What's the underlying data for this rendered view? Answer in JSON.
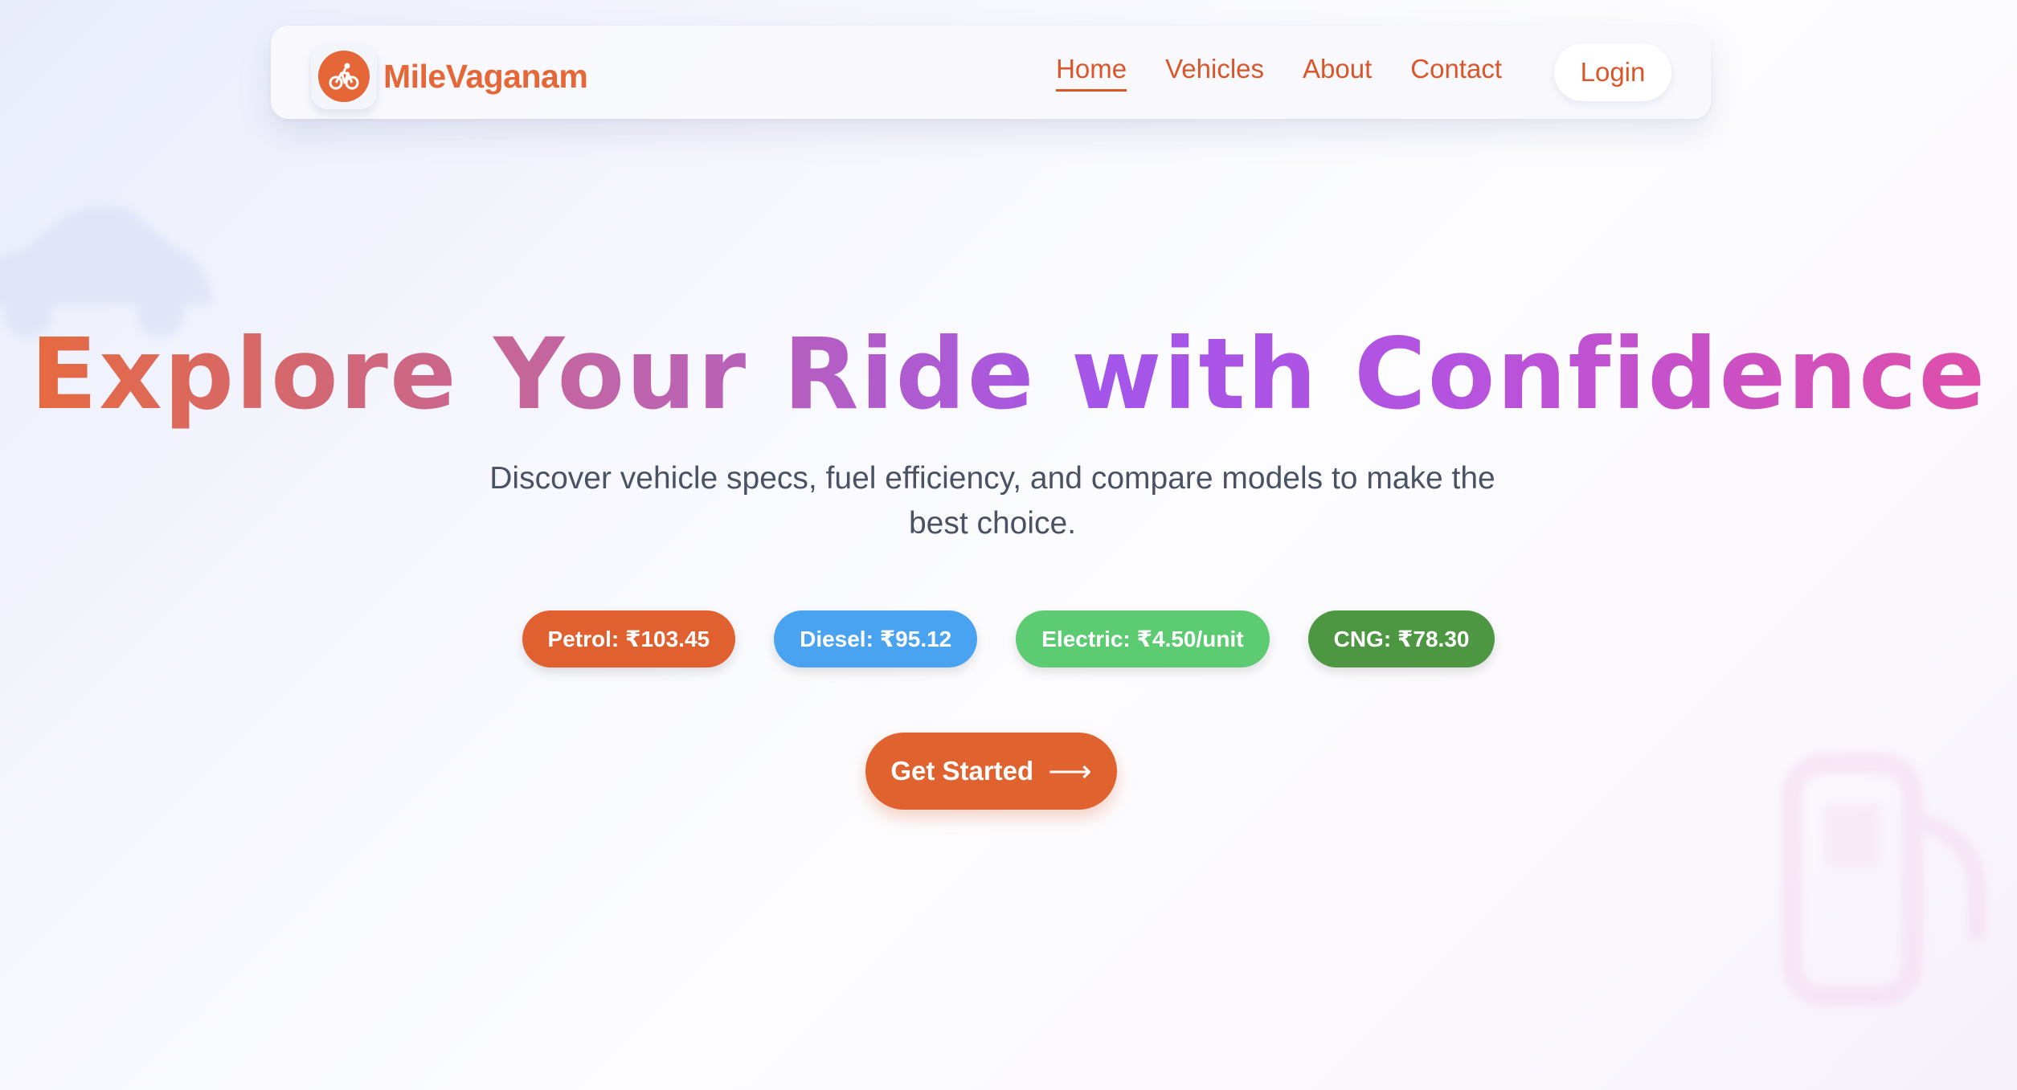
{
  "brand": {
    "name": "MileVaganam",
    "logo_icon": "motorcycle-rider-icon"
  },
  "nav": {
    "links": [
      {
        "label": "Home",
        "active": true
      },
      {
        "label": "Vehicles",
        "active": false
      },
      {
        "label": "About",
        "active": false
      },
      {
        "label": "Contact",
        "active": false
      }
    ],
    "login_label": "Login"
  },
  "hero": {
    "title": "Explore Your Ride with Confidence",
    "subtitle": "Discover vehicle specs, fuel efficiency, and compare models to make the best choice."
  },
  "fuel_prices": [
    {
      "label": "Petrol: ₹103.45",
      "color": "#e0612f"
    },
    {
      "label": "Diesel: ₹95.12",
      "color": "#4aa3f0"
    },
    {
      "label": "Electric: ₹4.50/unit",
      "color": "#5ccb72"
    },
    {
      "label": "CNG: ₹78.30",
      "color": "#4d9642"
    }
  ],
  "cta": {
    "label": "Get Started",
    "icon": "arrow-right-icon"
  },
  "colors": {
    "accent": "#e56637",
    "nav_text": "#d9562b"
  }
}
